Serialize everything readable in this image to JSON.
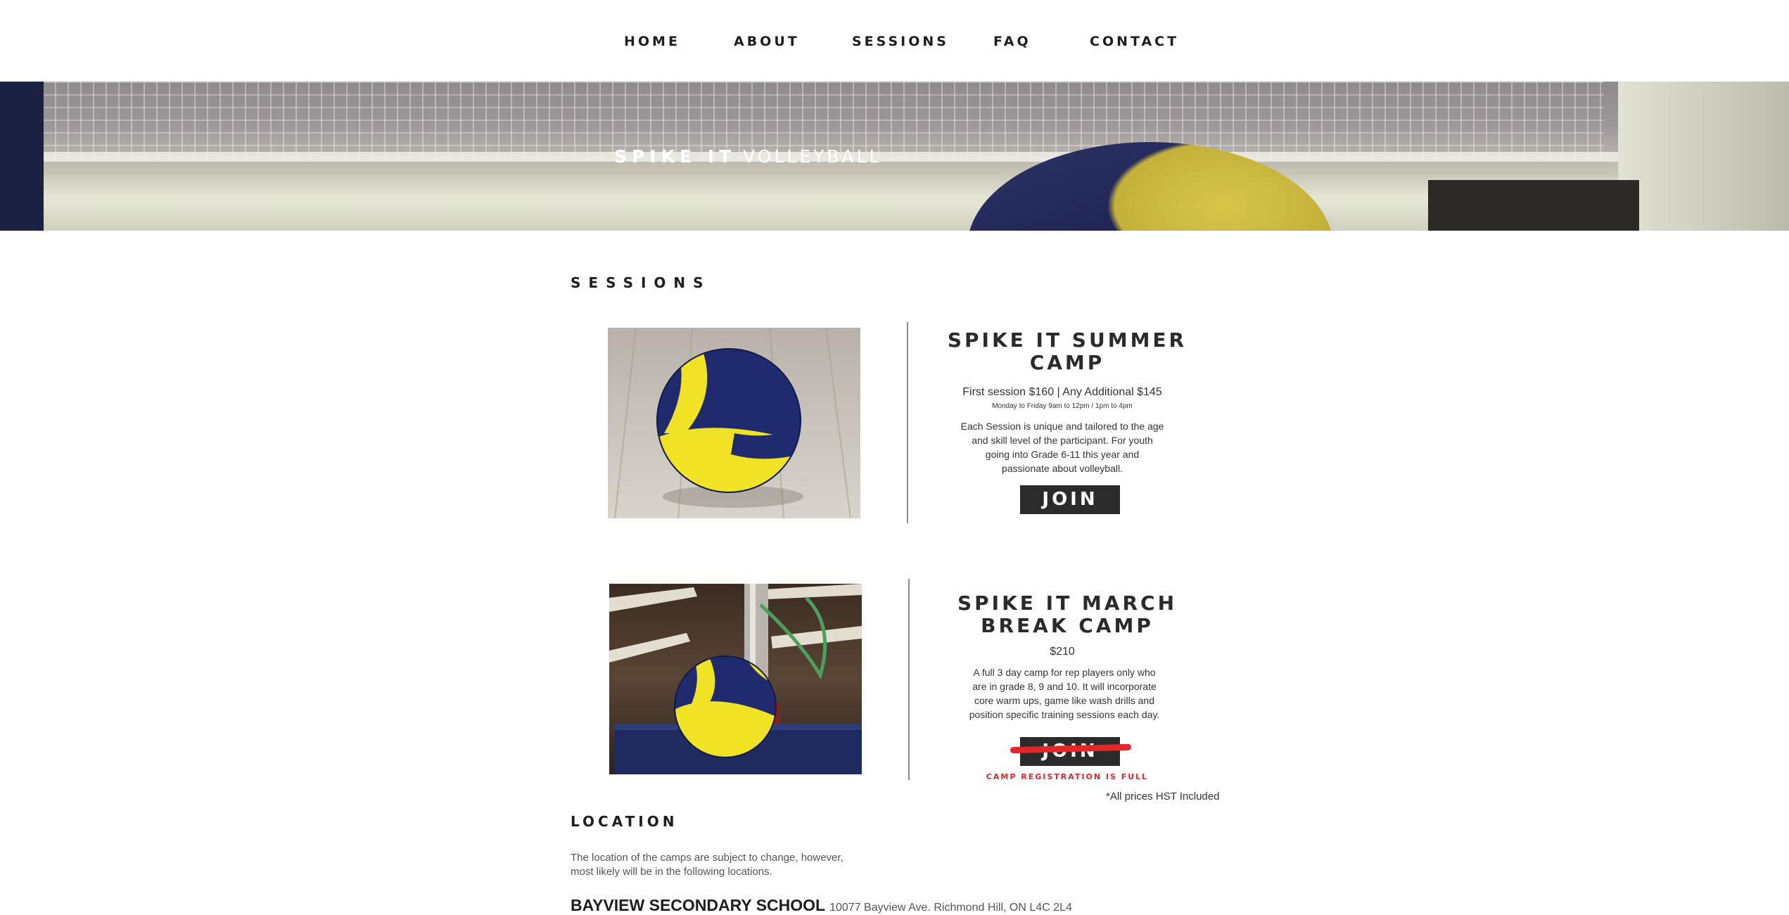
{
  "nav": {
    "items": [
      {
        "label": "HOME"
      },
      {
        "label": "ABOUT"
      },
      {
        "label": "SESSIONS"
      },
      {
        "label": "FAQ"
      },
      {
        "label": "CONTACT"
      }
    ]
  },
  "hero": {
    "brand_bold": "SPIKE IT",
    "brand_light": "VOLLEYBALL"
  },
  "sessions": {
    "heading": "SESSIONS",
    "cards": [
      {
        "title_line1": "SPIKE IT SUMMER",
        "title_line2": "CAMP",
        "price": "First session $160 | Any Additional $145",
        "schedule": "Monday to Friday 9am to 12pm / 1pm to 4pm",
        "desc_lines": [
          "Each Session is unique and tailored to the age",
          "and skill level of the participant. For youth",
          "going into Grade 6-11 this year and",
          "passionate about volleyball."
        ],
        "button": "JOIN"
      },
      {
        "title_line1": "SPIKE IT MARCH",
        "title_line2": "BREAK CAMP",
        "price": "$210",
        "desc_lines": [
          "A full 3 day camp for rep players only who",
          "are in grade 8, 9 and 10. It will incorporate",
          "core warm ups, game like wash drills and",
          "position specific training sessions each day."
        ],
        "button": "JOIN",
        "status_note": "CAMP REGISTRATION IS FULL"
      }
    ],
    "hst_note": "*All prices HST Included"
  },
  "location": {
    "heading": "LOCATION",
    "text_line1": "The location of the camps are subject to change, however,",
    "text_line2": "most likely will be in the following locations.",
    "school_name": "BAYVIEW SECONDARY SCHOOL",
    "school_address": "10077 Bayview Ave. Richmond Hill, ON L4C 2L4"
  },
  "colors": {
    "accent_red": "#e3262a",
    "button_dark": "#2b2b2b",
    "ball_yellow": "#f0e224",
    "ball_navy": "#1f2b6e"
  }
}
